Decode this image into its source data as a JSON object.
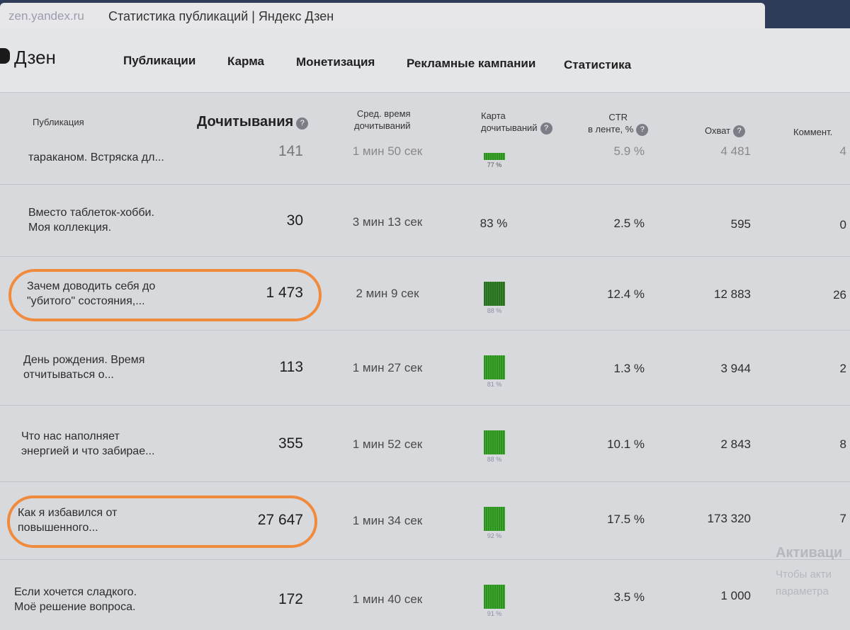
{
  "browser": {
    "tab_site": "zen.yandex.ru",
    "tab_title": "Статистика публикаций | Яндекс Дзен"
  },
  "brand": {
    "logo_text": "Дзен"
  },
  "nav": {
    "items": [
      "Публикации",
      "Карма",
      "Монетизация",
      "Рекламные кампании",
      "Статистика"
    ]
  },
  "table": {
    "headers": {
      "publication": "Публикация",
      "reads": "Дочитывания",
      "time_line1": "Сред. время",
      "time_line2": "дочитываний",
      "map_line1": "Карта",
      "map_line2": "дочитываний",
      "ctr_line1": "CTR",
      "ctr_line2": "в ленте, %",
      "reach": "Охват",
      "comments": "Коммент.",
      "help_icon": "?"
    },
    "rows": [
      {
        "title_line1": "тараканом. Встряска дл...",
        "title_line2": "",
        "reads": "141",
        "time": "1 мин 50 сек",
        "map_pct": "77 %",
        "map_style": "small-bar",
        "ctr": "5.9 %",
        "reach": "4 481",
        "comments": "4"
      },
      {
        "title_line1": "Вместо таблеток-хобби.",
        "title_line2": "Моя коллекция.",
        "reads": "30",
        "time": "3 мин 13 сек",
        "map_pct": "83 %",
        "map_style": "text",
        "ctr": "2.5 %",
        "reach": "595",
        "comments": "0"
      },
      {
        "title_line1": "Зачем доводить себя до",
        "title_line2": "\"убитого\" состояния,...",
        "reads": "1 473",
        "time": "2 мин 9 сек",
        "map_pct": "88 %",
        "map_style": "bar-dark",
        "ctr": "12.4 %",
        "reach": "12 883",
        "comments": "26"
      },
      {
        "title_line1": "День рождения. Время",
        "title_line2": "отчитываться о...",
        "reads": "113",
        "time": "1 мин 27 сек",
        "map_pct": "81 %",
        "map_style": "bar",
        "ctr": "1.3 %",
        "reach": "3 944",
        "comments": "2"
      },
      {
        "title_line1": "Что нас наполняет",
        "title_line2": "энергией и что забирае...",
        "reads": "355",
        "time": "1 мин 52 сек",
        "map_pct": "88 %",
        "map_style": "bar",
        "ctr": "10.1 %",
        "reach": "2 843",
        "comments": "8"
      },
      {
        "title_line1": "Как я избавился от",
        "title_line2": "повышенного...",
        "reads": "27 647",
        "time": "1 мин 34 сек",
        "map_pct": "92 %",
        "map_style": "bar",
        "ctr": "17.5 %",
        "reach": "173 320",
        "comments": "7"
      },
      {
        "title_line1": "Если хочется сладкого.",
        "title_line2": "Моё решение вопроса.",
        "reads": "172",
        "time": "1 мин 40 сек",
        "map_pct": "91 %",
        "map_style": "bar",
        "ctr": "3.5 %",
        "reach": "1 000",
        "comments": ""
      }
    ]
  },
  "watermark": {
    "line1": "Активаци",
    "line2": "Чтобы акти",
    "line3": "параметра"
  },
  "colors": {
    "tab_bar": "#2e3c57",
    "bar_green": "#3fb030",
    "bar_dark_green": "#2a6e22",
    "highlight_orange": "#f08a3c"
  }
}
